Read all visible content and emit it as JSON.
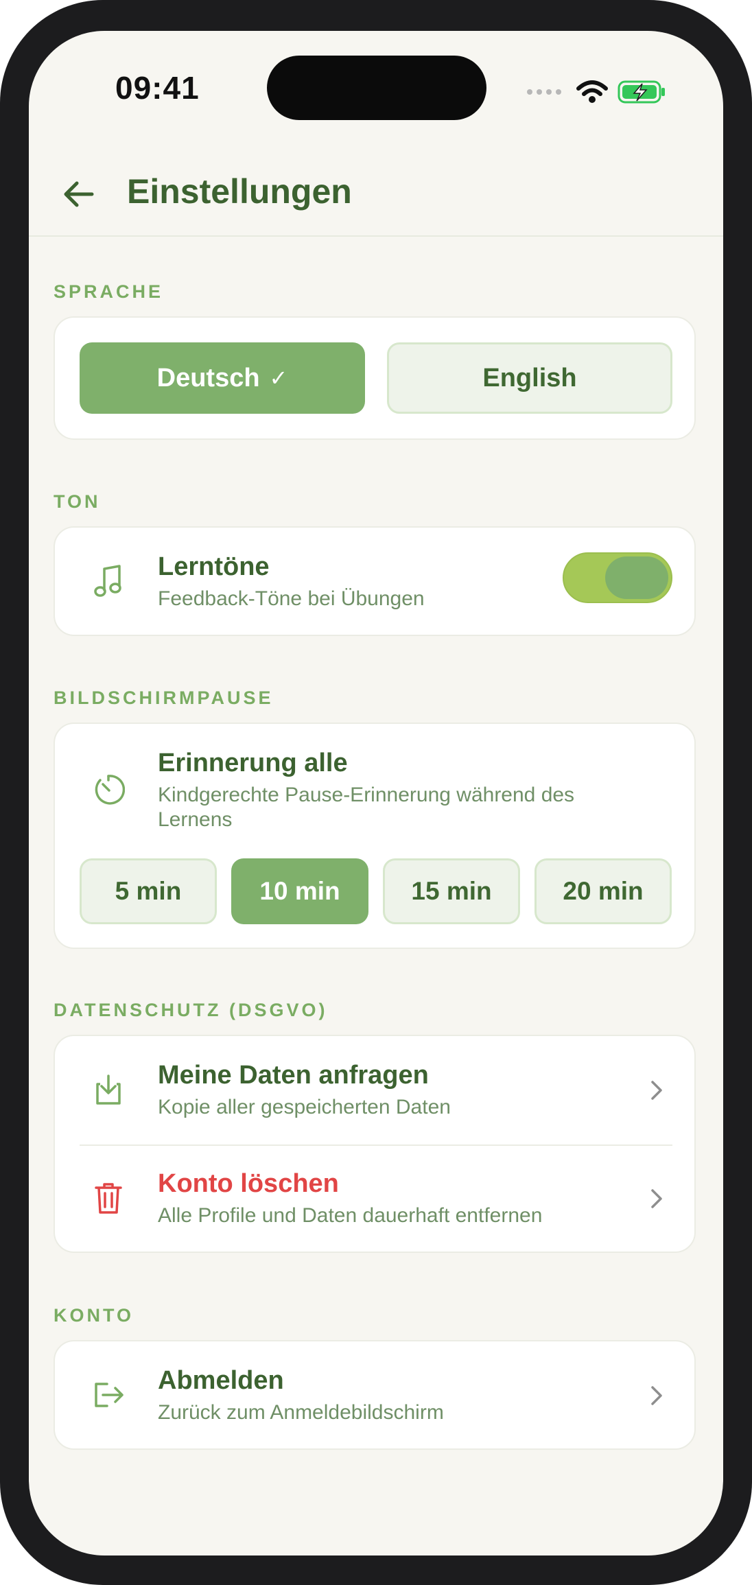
{
  "status_bar": {
    "time": "09:41"
  },
  "header": {
    "title": "Einstellungen",
    "back_icon": "arrow-left-icon"
  },
  "colors": {
    "accent": "#7fb06b",
    "title": "#3c6230",
    "section": "#7aac62",
    "danger": "#e14545",
    "toggle_on": "#a5c857",
    "background": "#f7f6f1"
  },
  "language": {
    "section_label": "SPRACHE",
    "options": [
      {
        "label": "Deutsch",
        "selected": true,
        "check": "✓"
      },
      {
        "label": "English",
        "selected": false
      }
    ]
  },
  "sound": {
    "section_label": "TON",
    "icon": "music-note-icon",
    "title": "Lerntöne",
    "subtitle": "Feedback-Töne bei Übungen",
    "enabled": true
  },
  "screen_break": {
    "section_label": "BILDSCHIRMPAUSE",
    "icon": "timer-icon",
    "title": "Erinnerung alle",
    "subtitle": "Kindgerechte Pause-Erinnerung während des Lernens",
    "options": [
      {
        "label": "5 min",
        "selected": false
      },
      {
        "label": "10 min",
        "selected": true
      },
      {
        "label": "15 min",
        "selected": false
      },
      {
        "label": "20 min",
        "selected": false
      }
    ]
  },
  "privacy": {
    "section_label": "DATENSCHUTZ (DSGVO)",
    "items": [
      {
        "icon": "download-icon",
        "title": "Meine Daten anfragen",
        "subtitle": "Kopie aller gespeicherten Daten"
      },
      {
        "icon": "trash-icon",
        "title": "Konto löschen",
        "subtitle": "Alle Profile und Daten dauerhaft entfernen",
        "danger": true
      }
    ]
  },
  "account": {
    "section_label": "KONTO",
    "items": [
      {
        "icon": "logout-icon",
        "title": "Abmelden",
        "subtitle": "Zurück zum Anmeldebildschirm"
      }
    ]
  }
}
